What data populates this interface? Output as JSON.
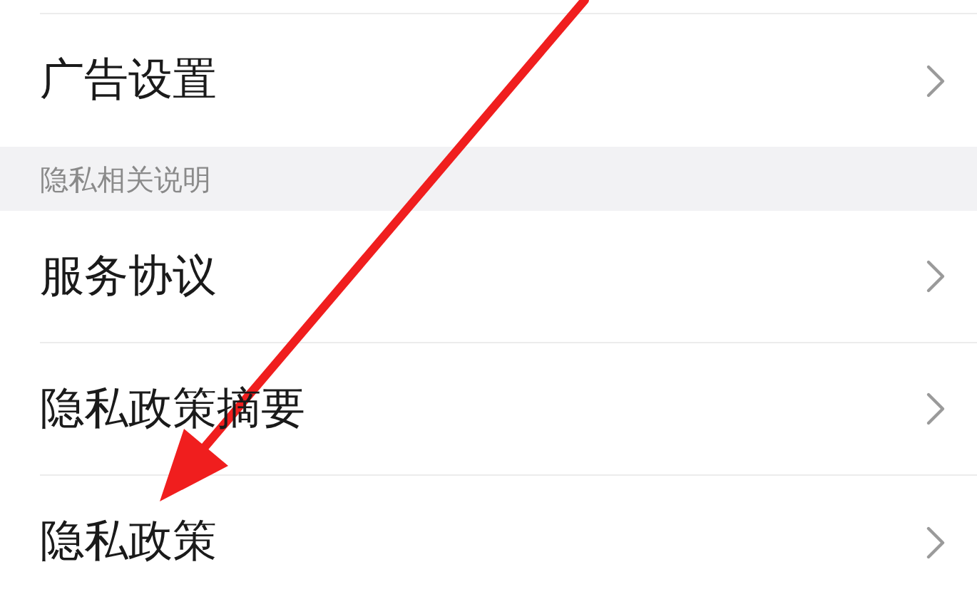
{
  "rows": [
    {
      "kind": "item",
      "label": "广告设置"
    },
    {
      "kind": "header",
      "label": "隐私相关说明"
    },
    {
      "kind": "item",
      "label": "服务协议"
    },
    {
      "kind": "item",
      "label": "隐私政策摘要"
    },
    {
      "kind": "item",
      "label": "隐私政策"
    }
  ]
}
